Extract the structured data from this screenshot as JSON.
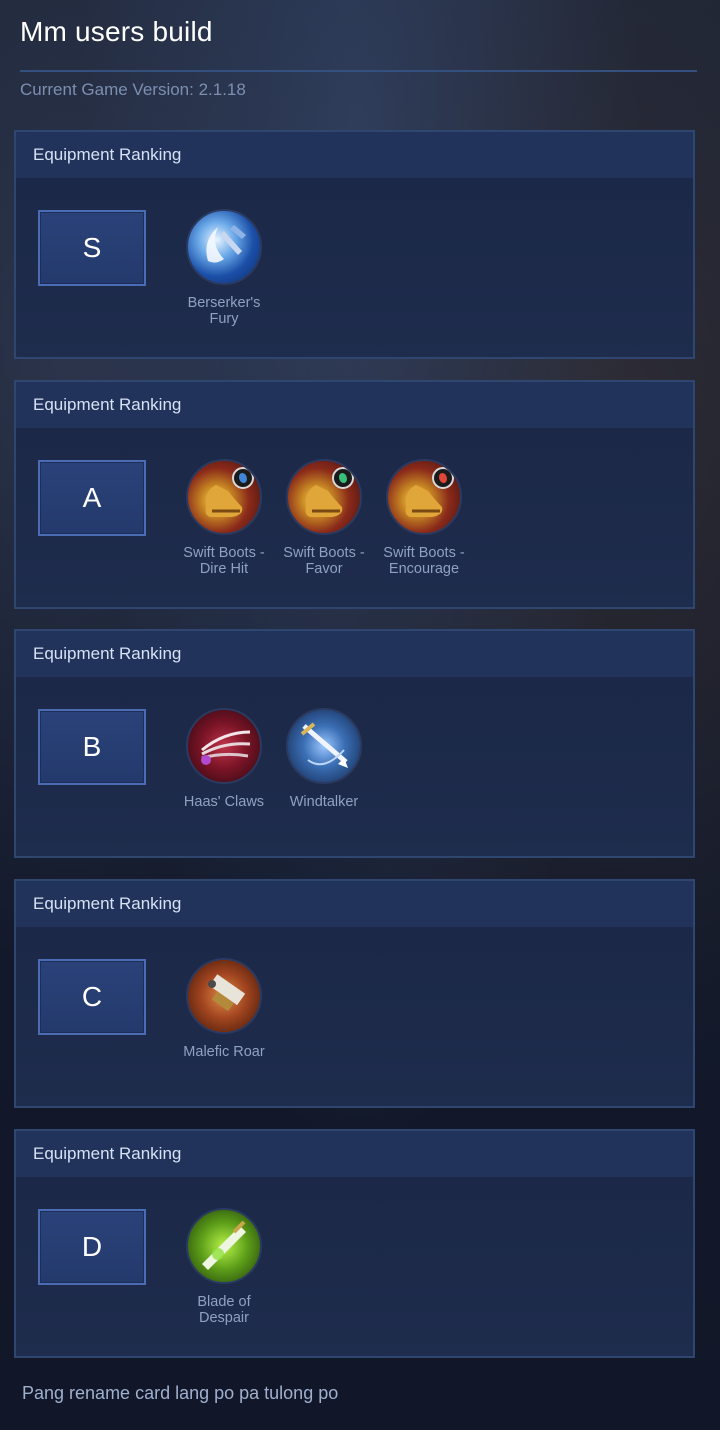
{
  "header": {
    "title": "Mm users build",
    "version_label": "Current Game Version: 2.1.18"
  },
  "tiers": [
    {
      "header": "Equipment Ranking",
      "rank": "S",
      "items": [
        {
          "name": "Berserker's Fury",
          "icon": "berserkers-fury-icon"
        }
      ]
    },
    {
      "header": "Equipment Ranking",
      "rank": "A",
      "items": [
        {
          "name": "Swift Boots - Dire Hit",
          "icon": "swift-boots-dire-hit-icon",
          "emblem_color": "#3f86d8"
        },
        {
          "name": "Swift Boots - Favor",
          "icon": "swift-boots-favor-icon",
          "emblem_color": "#38c07a"
        },
        {
          "name": "Swift Boots - Encourage",
          "icon": "swift-boots-encourage-icon",
          "emblem_color": "#e0463a"
        }
      ]
    },
    {
      "header": "Equipment Ranking",
      "rank": "B",
      "items": [
        {
          "name": "Haas' Claws",
          "icon": "haas-claws-icon"
        },
        {
          "name": "Windtalker",
          "icon": "windtalker-icon"
        }
      ]
    },
    {
      "header": "Equipment Ranking",
      "rank": "C",
      "items": [
        {
          "name": "Malefic Roar",
          "icon": "malefic-roar-icon"
        }
      ]
    },
    {
      "header": "Equipment Ranking",
      "rank": "D",
      "items": [
        {
          "name": "Blade of Despair",
          "icon": "blade-of-despair-icon"
        }
      ]
    }
  ],
  "footer": {
    "comment": "Pang rename card lang po pa tulong po"
  }
}
